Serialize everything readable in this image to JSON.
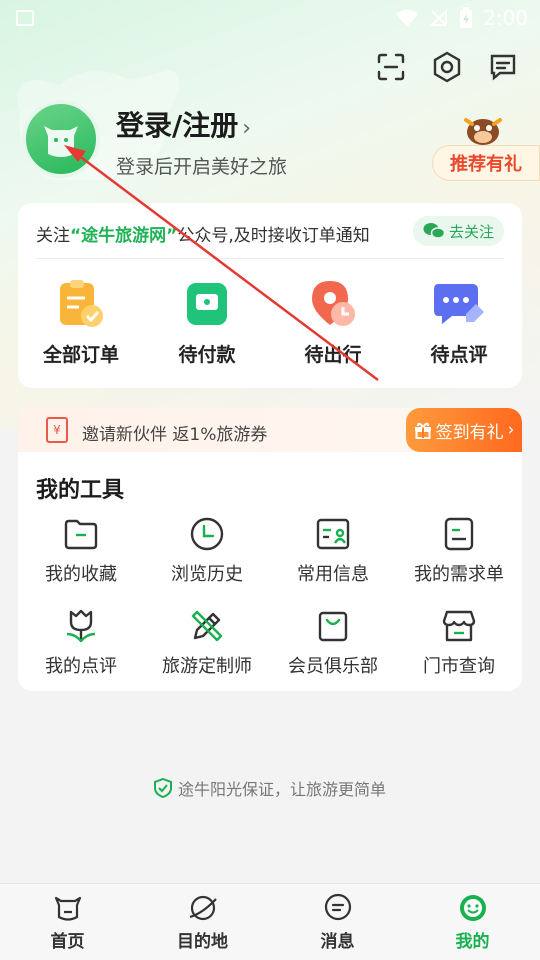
{
  "status_bar": {
    "time": "2:00"
  },
  "profile": {
    "title": "登录/注册",
    "chevron": "›",
    "subtitle": "登录后开启美好之旅",
    "recommend": "推荐有礼"
  },
  "orders": {
    "notice_prefix": "关注",
    "notice_highlight": "“途牛旅游网”",
    "notice_suffix": "公众号,及时接收订单通知",
    "follow_label": "去关注",
    "items": [
      {
        "label": "全部订单",
        "icon": "clipboard-check-icon"
      },
      {
        "label": "待付款",
        "icon": "wallet-icon"
      },
      {
        "label": "待出行",
        "icon": "clock-location-icon"
      },
      {
        "label": "待点评",
        "icon": "chat-edit-icon"
      }
    ]
  },
  "tools": {
    "invite_text": "邀请新伙伴 返1%旅游券",
    "invite_icon_text": "¥",
    "sign_label": "签到有礼",
    "title": "我的工具",
    "items": [
      {
        "label": "我的收藏",
        "icon": "folder-icon"
      },
      {
        "label": "浏览历史",
        "icon": "clock-icon"
      },
      {
        "label": "常用信息",
        "icon": "id-card-icon"
      },
      {
        "label": "我的需求单",
        "icon": "document-icon"
      },
      {
        "label": "我的点评",
        "icon": "tulip-icon"
      },
      {
        "label": "旅游定制师",
        "icon": "pencil-ruler-icon"
      },
      {
        "label": "会员俱乐部",
        "icon": "shopping-bag-icon"
      },
      {
        "label": "门市查询",
        "icon": "store-icon"
      }
    ]
  },
  "footer": {
    "guarantee": "途牛阳光保证，让旅游更简单"
  },
  "bottom_nav": [
    {
      "label": "首页",
      "icon": "home-cow-icon"
    },
    {
      "label": "目的地",
      "icon": "planet-icon"
    },
    {
      "label": "消息",
      "icon": "message-icon"
    },
    {
      "label": "我的",
      "icon": "smiley-icon",
      "active": true
    }
  ],
  "colors": {
    "brand_green": "#19b04f",
    "accent_orange": "#ff7a2a",
    "annotation_red": "#e53935"
  }
}
